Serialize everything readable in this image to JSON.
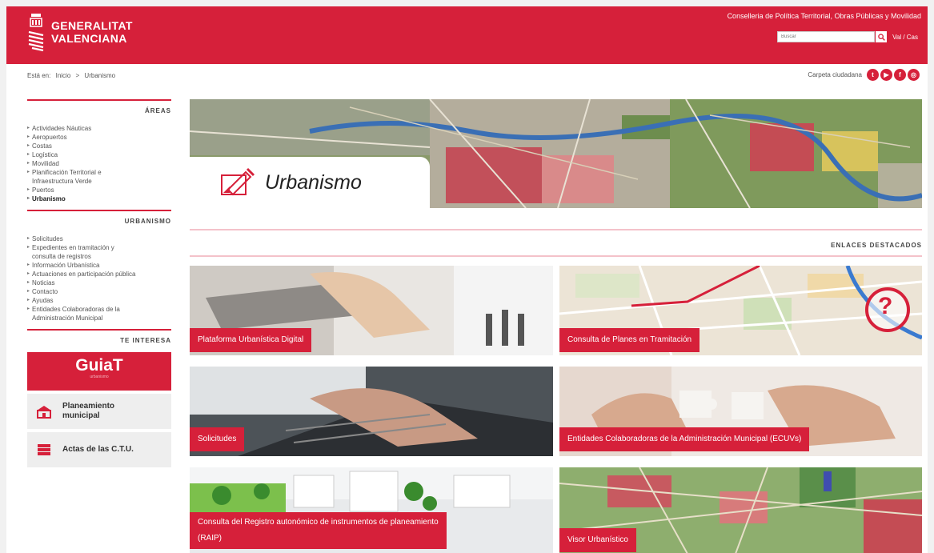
{
  "header": {
    "org_line1": "GENERALITAT",
    "org_line2": "VALENCIANA",
    "department": "Conselleria de Política Territorial, Obras Públicas y Movilidad",
    "search_placeholder": "Buscar",
    "language": "Val / Cas",
    "brand_color": "#d6203a"
  },
  "topbar": {
    "breadcrumb_prefix": "Está en:",
    "breadcrumb_home": "Inicio",
    "breadcrumb_sep": ">",
    "breadcrumb_current": "Urbanismo",
    "carpeta": "Carpeta ciudadana",
    "social": [
      "twitter-icon",
      "youtube-icon",
      "facebook-icon",
      "instagram-icon"
    ]
  },
  "sidebar": {
    "areas_title": "ÁREAS",
    "areas": [
      "Actividades Náuticas",
      "Aeropuertos",
      "Costas",
      "Logística",
      "Movilidad",
      "Planificación Territorial e",
      "Infraestructura Verde",
      "Puertos",
      "Urbanismo"
    ],
    "urbanismo_title": "URBANISMO",
    "urbanismo": [
      "Solicitudes",
      "Expedientes en tramitación y",
      "consulta de registros",
      "Información Urbanística",
      "Actuaciones en participación pública",
      "Noticias",
      "Contacto",
      "Ayudas",
      "Entidades Colaboradoras de la",
      "Administración Municipal"
    ],
    "interesa_title": "TE INTERESA",
    "guia_title": "GuiaT",
    "guia_sub": "urbanismo",
    "card1_line1": "Planeamiento",
    "card1_line2": "municipal",
    "card2": "Actas de las C.T.U."
  },
  "main": {
    "banner_title": "Urbanismo",
    "enlaces_title": "ENLACES DESTACADOS",
    "tiles": [
      "Plataforma Urbanística Digital",
      "Consulta de Planes en Tramitación",
      "Solicitudes",
      "Entidades Colaboradoras de la Administración Municipal (ECUVs)",
      "Consulta del Registro autonómico de instrumentos de planeamiento",
      "(RAIP)",
      "Visor Urbanístico"
    ],
    "consulta_badge": "?"
  }
}
